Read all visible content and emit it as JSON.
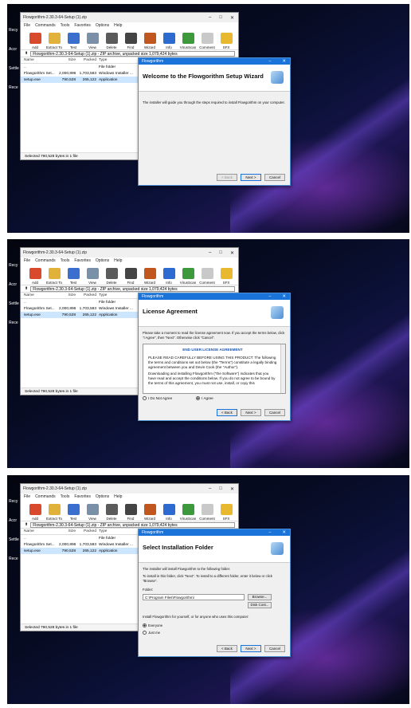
{
  "archive": {
    "title": "Flowgorithm-2.30.3-64-Setup (1).zip",
    "menu": [
      "File",
      "Commands",
      "Tools",
      "Favorites",
      "Options",
      "Help"
    ],
    "tools": [
      {
        "label": "Add",
        "color": "#d94a2c"
      },
      {
        "label": "Extract To",
        "color": "#e0b23a"
      },
      {
        "label": "Test",
        "color": "#3b6fcf"
      },
      {
        "label": "View",
        "color": "#7a8fa8"
      },
      {
        "label": "Delete",
        "color": "#5b5b5b"
      },
      {
        "label": "Find",
        "color": "#444"
      },
      {
        "label": "Wizard",
        "color": "#c2561f"
      },
      {
        "label": "Info",
        "color": "#2d6bd1"
      },
      {
        "label": "VirusScan",
        "color": "#3c9a3c"
      },
      {
        "label": "Comment",
        "color": "#c9c9c9"
      },
      {
        "label": "SFX",
        "color": "#e8b92f"
      }
    ],
    "path_text": "Flowgorithm-2.30.3-64-Setup (1).zip - ZIP archive, unpacked size 1,079,424 bytes",
    "columns": [
      "Name",
      "Size",
      "Packed",
      "Type"
    ],
    "rows": [
      {
        "name": "..",
        "size": "",
        "packed": "",
        "type": "File folder"
      },
      {
        "name": "Flowgorithm Set...",
        "size": "2,000,896",
        "packed": "1,703,583",
        "type": "Windows Installer ..."
      },
      {
        "name": "setup.exe",
        "size": "790,528",
        "packed": "265,122",
        "type": "Application"
      }
    ],
    "status": "Selected 790,528 bytes in 1 file",
    "status_right": "Tota"
  },
  "desktop_icons": [
    "Recy",
    "Accr",
    "Settle",
    "Rece"
  ],
  "dialog_title": "Flowgorithm",
  "step1": {
    "heading": "Welcome to the Flowgorithm Setup Wizard",
    "text": "The installer will guide you through the steps required to install Flowgorithm on your computer.",
    "back": "< Back",
    "next": "Next >",
    "cancel": "Cancel"
  },
  "step2": {
    "heading": "License Agreement",
    "intro": "Please take a moment to read the license agreement now. If you accept the terms below, click \"I Agree\", then \"Next\". Otherwise click \"Cancel\".",
    "lic_title": "END USER LICENSE AGREEMENT",
    "lic_p1": "PLEASE READ CAREFULLY BEFORE USING THIS PRODUCT: The following the terms and conditions set out below (the \"Terms\") constitute a legally binding agreement between you and Devin Cook (the \"Author\").",
    "lic_p2": "Downloading and installing Flowgorithm (\"the Software\") indicates that you have read and accept the conditions below. If you do not agree to be bound by the terms of this agreement, you must not use, install, or copy this",
    "disagree": "I Do Not Agree",
    "agree": "I Agree",
    "back": "< Back",
    "next": "Next >",
    "cancel": "Cancel"
  },
  "step3": {
    "heading": "Select Installation Folder",
    "text1": "The installer will install Flowgorithm to the following folder.",
    "text2": "To install in this folder, click \"Next\". To install to a different folder, enter it below or click \"Browse\".",
    "folder_label": "Folder:",
    "folder_value": "C:\\Program Files\\Flowgorithm\\",
    "browse": "Browse...",
    "disk_cost": "Disk Cost...",
    "for_text": "Install Flowgorithm for yourself, or for anyone who uses this computer:",
    "everyone": "Everyone",
    "just_me": "Just me",
    "back": "< Back",
    "next": "Next >",
    "cancel": "Cancel"
  }
}
